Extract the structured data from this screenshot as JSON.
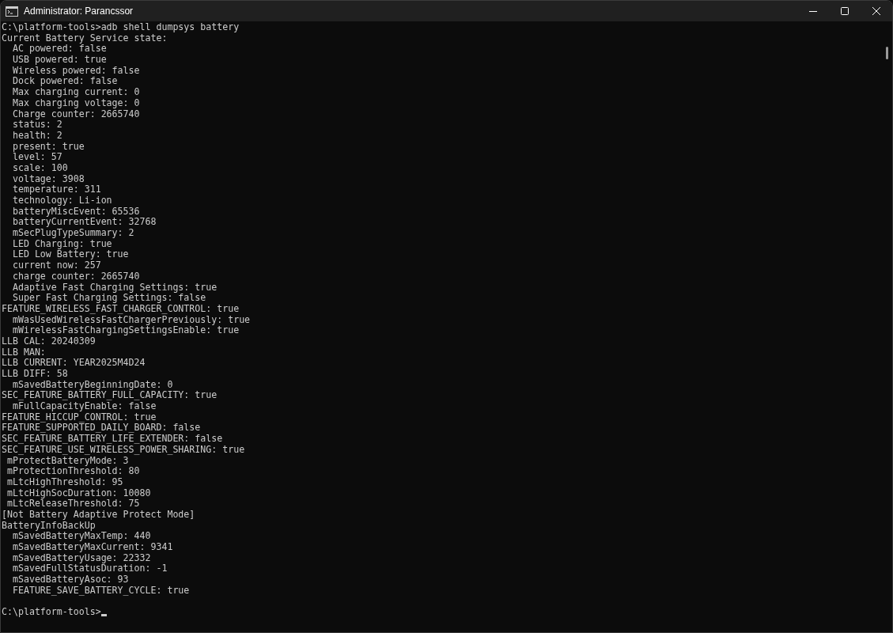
{
  "window": {
    "title": "Administrator: Parancssor"
  },
  "terminal": {
    "lines": [
      "C:\\platform-tools>adb shell dumpsys battery",
      "Current Battery Service state:",
      "  AC powered: false",
      "  USB powered: true",
      "  Wireless powered: false",
      "  Dock powered: false",
      "  Max charging current: 0",
      "  Max charging voltage: 0",
      "  Charge counter: 2665740",
      "  status: 2",
      "  health: 2",
      "  present: true",
      "  level: 57",
      "  scale: 100",
      "  voltage: 3908",
      "  temperature: 311",
      "  technology: Li-ion",
      "  batteryMiscEvent: 65536",
      "  batteryCurrentEvent: 32768",
      "  mSecPlugTypeSummary: 2",
      "  LED Charging: true",
      "  LED Low Battery: true",
      "  current now: 257",
      "  charge counter: 2665740",
      "  Adaptive Fast Charging Settings: true",
      "  Super Fast Charging Settings: false",
      "FEATURE_WIRELESS_FAST_CHARGER_CONTROL: true",
      "  mWasUsedWirelessFastChargerPreviously: true",
      "  mWirelessFastChargingSettingsEnable: true",
      "LLB CAL: 20240309",
      "LLB MAN:",
      "LLB CURRENT: YEAR2025M4D24",
      "LLB DIFF: 58",
      "  mSavedBatteryBeginningDate: 0",
      "SEC_FEATURE_BATTERY_FULL_CAPACITY: true",
      "  mFullCapacityEnable: false",
      "FEATURE_HICCUP_CONTROL: true",
      "FEATURE_SUPPORTED_DAILY_BOARD: false",
      "SEC_FEATURE_BATTERY_LIFE_EXTENDER: false",
      "SEC_FEATURE_USE_WIRELESS_POWER_SHARING: true",
      " mProtectBatteryMode: 3",
      " mProtectionThreshold: 80",
      " mLtcHighThreshold: 95",
      " mLtcHighSocDuration: 10080",
      " mLtcReleaseThreshold: 75",
      "[Not Battery Adaptive Protect Mode]",
      "BatteryInfoBackUp",
      "  mSavedBatteryMaxTemp: 440",
      "  mSavedBatteryMaxCurrent: 9341",
      "  mSavedBatteryUsage: 22332",
      "  mSavedFullStatusDuration: -1",
      "  mSavedBatteryAsoc: 93",
      "  FEATURE_SAVE_BATTERY_CYCLE: true"
    ],
    "prompt": "C:\\platform-tools>"
  }
}
